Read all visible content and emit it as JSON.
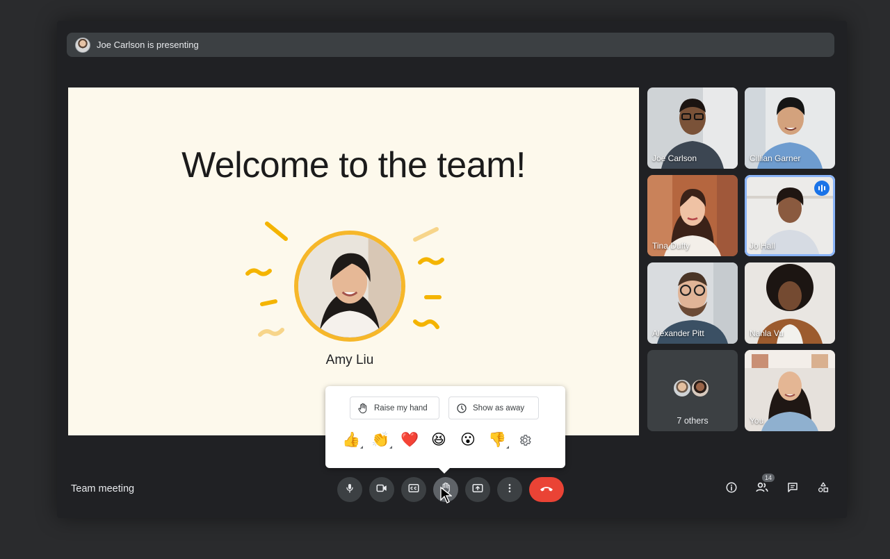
{
  "banner": {
    "text": "Joe Carlson is presenting"
  },
  "slide": {
    "title": "Welcome to the team!",
    "person_name": "Amy Liu"
  },
  "participants": [
    {
      "name": "Joe Carlson"
    },
    {
      "name": "Cillian Garner"
    },
    {
      "name": "Tina Duffy"
    },
    {
      "name": "Jo Hall",
      "speaking": true
    },
    {
      "name": "Alexander Pitt"
    },
    {
      "name": "Nahla Vu"
    },
    {
      "name": "You"
    }
  ],
  "others": {
    "label": "7 others"
  },
  "reactions": {
    "raise_hand_label": "Raise my hand",
    "show_away_label": "Show as away",
    "emojis": [
      "👍",
      "👏",
      "❤️",
      "😆",
      "😮",
      "👎"
    ]
  },
  "meeting": {
    "name": "Team meeting"
  },
  "people_count": "14",
  "icons": {
    "mic": "mic-icon",
    "camera": "camera-icon",
    "captions": "captions-icon",
    "reactions": "raise-hand-icon",
    "present": "present-icon",
    "more": "more-icon",
    "end_call": "end-call-icon",
    "info": "info-icon",
    "people": "people-icon",
    "chat": "chat-icon",
    "activities": "activities-icon"
  },
  "colors": {
    "accent": "#8ab4f8",
    "end_call": "#ea4335",
    "highlight": "#f6b72a"
  }
}
